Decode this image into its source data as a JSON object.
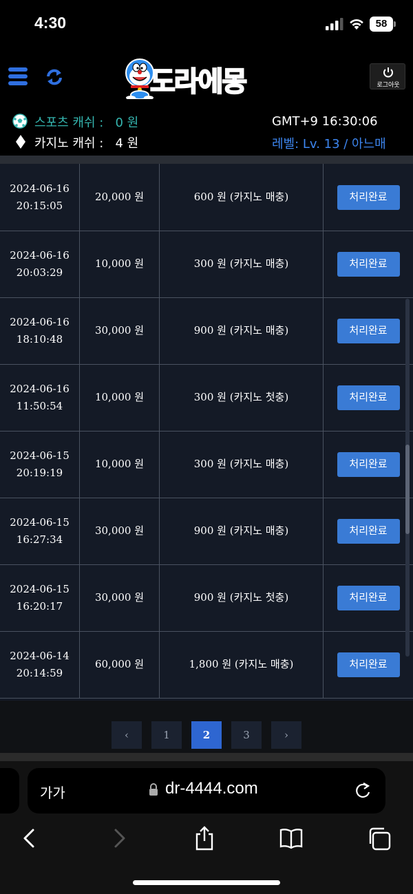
{
  "status_bar": {
    "time": "4:30",
    "battery": "58"
  },
  "header": {
    "logo_text": "도라에몽",
    "logout_label": "로그아웃"
  },
  "info": {
    "sports_cash": "스포츠 캐쉬 :   0 원",
    "casino_cash": "카지노 캐쉬 :   4 원",
    "clock": "GMT+9 16:30:06",
    "level": "레벨: Lv. 13 / 아느매"
  },
  "rows": [
    {
      "date": "2024-06-16",
      "time": "20:15:05",
      "amount": "20,000 원",
      "bonus": "600 원 (카지노 매충)",
      "status": "처리완료"
    },
    {
      "date": "2024-06-16",
      "time": "20:03:29",
      "amount": "10,000 원",
      "bonus": "300 원 (카지노 매충)",
      "status": "처리완료"
    },
    {
      "date": "2024-06-16",
      "time": "18:10:48",
      "amount": "30,000 원",
      "bonus": "900 원 (카지노 매충)",
      "status": "처리완료"
    },
    {
      "date": "2024-06-16",
      "time": "11:50:54",
      "amount": "10,000 원",
      "bonus": "300 원 (카지노 첫충)",
      "status": "처리완료"
    },
    {
      "date": "2024-06-15",
      "time": "20:19:19",
      "amount": "10,000 원",
      "bonus": "300 원 (카지노 매충)",
      "status": "처리완료"
    },
    {
      "date": "2024-06-15",
      "time": "16:27:34",
      "amount": "30,000 원",
      "bonus": "900 원 (카지노 매충)",
      "status": "처리완료"
    },
    {
      "date": "2024-06-15",
      "time": "16:20:17",
      "amount": "30,000 원",
      "bonus": "900 원 (카지노 첫충)",
      "status": "처리완료"
    },
    {
      "date": "2024-06-14",
      "time": "20:14:59",
      "amount": "60,000 원",
      "bonus": "1,800 원 (카지노 매충)",
      "status": "처리완료"
    }
  ],
  "pagination": {
    "prev": "‹",
    "pages": [
      "1",
      "2",
      "3"
    ],
    "active": "2",
    "next": "›"
  },
  "browser": {
    "aa": "가가",
    "url": "dr-4444.com"
  },
  "colors": {
    "accent": "#3a7bd5",
    "table_bg": "#141a26",
    "teal": "#35b6b0",
    "level_blue": "#3d86f0"
  }
}
